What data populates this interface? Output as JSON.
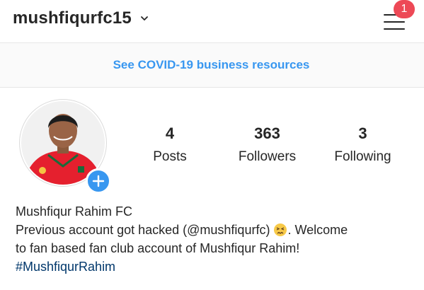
{
  "header": {
    "username": "mushfiqurfc15",
    "notification_count": "1",
    "icons": {
      "dropdown": "chevron-down-icon",
      "menu": "hamburger-menu-icon"
    }
  },
  "banner": {
    "text": "See COVID-19 business resources",
    "color": "#3897f0"
  },
  "profile": {
    "avatar_icon": "profile-photo",
    "add_story_icon": "plus-icon",
    "stats": [
      {
        "value": "4",
        "label": "Posts"
      },
      {
        "value": "363",
        "label": "Followers"
      },
      {
        "value": "3",
        "label": "Following"
      }
    ],
    "name": "Mushfiqur Rahim FC",
    "bio_line1_pre": "Previous account got hacked (@mushfiqurfc) ",
    "bio_emoji": "persevering-face-emoji",
    "bio_line1_post": ". Welcome",
    "bio_line2": "to fan based fan club account of Mushfiqur Rahim!",
    "hashtag": "#MushfiqurRahim"
  },
  "colors": {
    "accent": "#3897f0",
    "badge": "#ed4956",
    "jersey": "#e5202e",
    "hashtag": "#00376b"
  }
}
